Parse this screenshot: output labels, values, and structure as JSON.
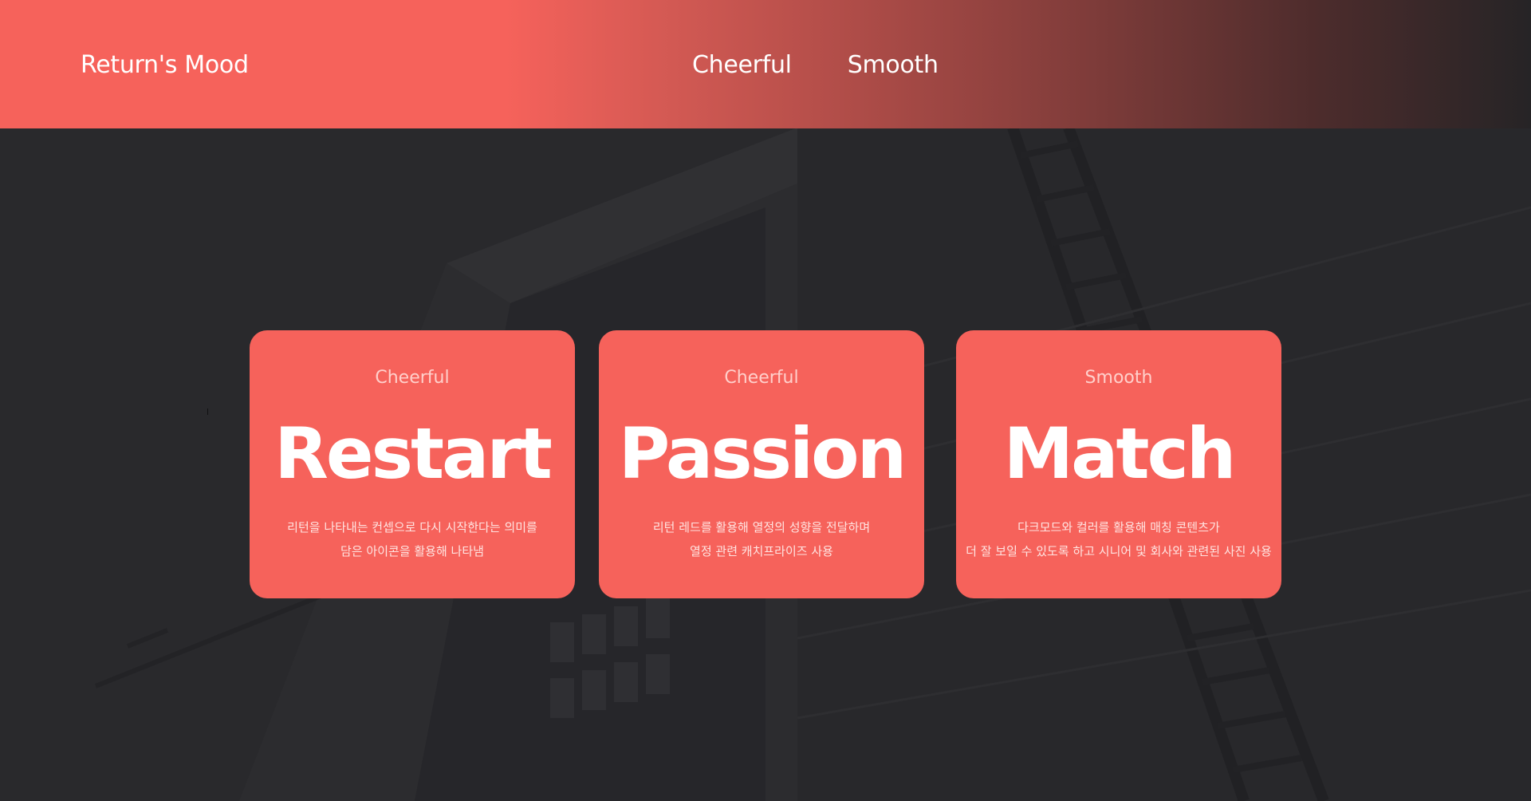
{
  "header": {
    "logo": "Return's Mood",
    "nav": [
      {
        "label": "Cheerful"
      },
      {
        "label": "Smooth"
      }
    ]
  },
  "cards": [
    {
      "tag": "Cheerful",
      "title": "Restart",
      "desc": [
        "리턴을 나타내는 컨셉으로 다시 시작한다는 의미를",
        "담은 아이콘을 활용해 나타냄"
      ]
    },
    {
      "tag": "Cheerful",
      "title": "Passion",
      "desc": [
        "리턴 레드를 활용해 열정의 성향을 전달하며",
        "열정 관련 캐치프라이즈 사용"
      ]
    },
    {
      "tag": "Smooth",
      "title": "Match",
      "desc": [
        "다크모드와 컬러를 활용해  매칭 콘텐츠가",
        "더 잘 보일 수 있도록 하고 시니어 및 회사와 관련된 사진 사용"
      ]
    }
  ],
  "colors": {
    "accent": "#f6625b",
    "background": "#29292c",
    "text": "#ffffff"
  }
}
